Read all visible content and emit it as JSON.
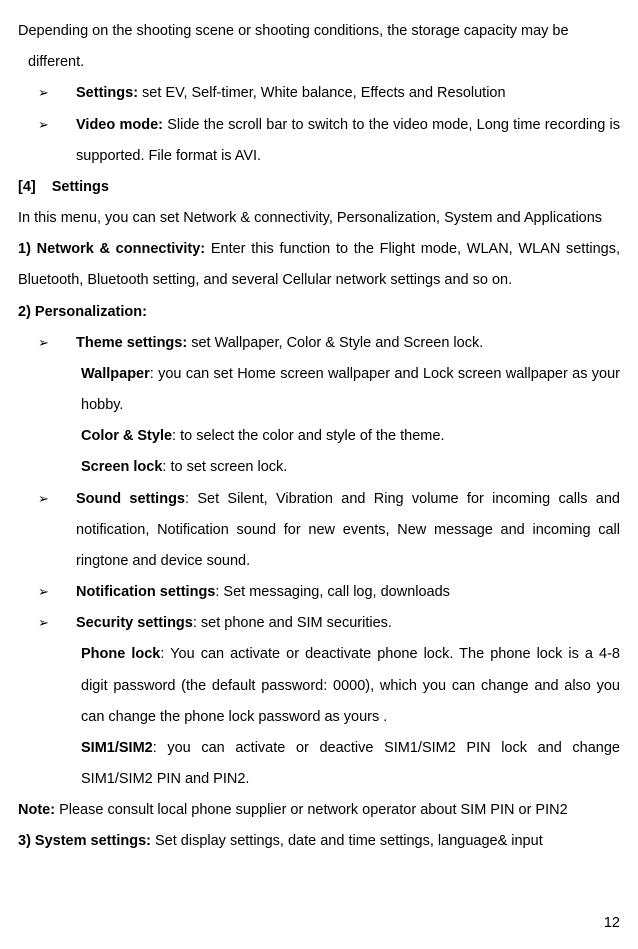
{
  "intro": {
    "line1": "Depending on the shooting scene or shooting conditions, the storage capacity may be",
    "line2": "different.",
    "indent_space": " "
  },
  "bullets1": [
    {
      "label": "Settings:",
      "text": " set EV, Self-timer, White balance, Effects and Resolution"
    },
    {
      "label": "Video mode:",
      "text": " Slide the scroll bar to switch to the video mode, Long time recording is supported. File format is AVI."
    }
  ],
  "settings": {
    "number": "[4]",
    "title": "Settings",
    "desc": "In this menu, you can set Network & connectivity, Personalization, System and Applications"
  },
  "section1": {
    "label": "1) Network & connectivity:",
    "text": " Enter this function to the Flight mode, WLAN, WLAN settings, Bluetooth, Bluetooth setting, and several Cellular network settings and so on."
  },
  "section2": {
    "label": "2) Personalization:"
  },
  "pers_bullets": [
    {
      "label": "Theme settings:",
      "text": " set Wallpaper, Color & Style and Screen lock.",
      "subs": [
        {
          "bold": "Wallpaper",
          "text": ": you can set Home screen wallpaper and Lock screen wallpaper as your hobby."
        },
        {
          "bold": "Color & Style",
          "text": ": to select the color and style of the theme."
        },
        {
          "bold": "Screen lock",
          "text": ": to set screen lock."
        }
      ]
    },
    {
      "label": "Sound settings",
      "text": ": Set Silent, Vibration and Ring volume for incoming calls and notification, Notification sound for new events, New message and incoming call ringtone and device sound.",
      "subs": []
    },
    {
      "label": "Notification settings",
      "text": ": Set messaging, call log, downloads",
      "subs": []
    },
    {
      "label": "Security settings",
      "text": ": set phone and SIM securities.",
      "subs": [
        {
          "bold": "Phone lock",
          "text": ": You can activate or deactivate phone lock. The phone lock is a 4-8 digit password (the default password: 0000), which you can change and also you can change the phone lock password as yours ."
        },
        {
          "bold": "SIM1/SIM2",
          "text": ": you can activate or deactive SIM1/SIM2 PIN lock and change SIM1/SIM2 PIN and PIN2."
        }
      ]
    }
  ],
  "note": {
    "label": "Note:",
    "text": " Please consult local phone supplier or network operator about SIM PIN or PIN2"
  },
  "section3": {
    "label": "3) System settings:",
    "text": " Set display settings, date and time settings, language& input"
  },
  "page_number": "12",
  "arrow": "➢"
}
